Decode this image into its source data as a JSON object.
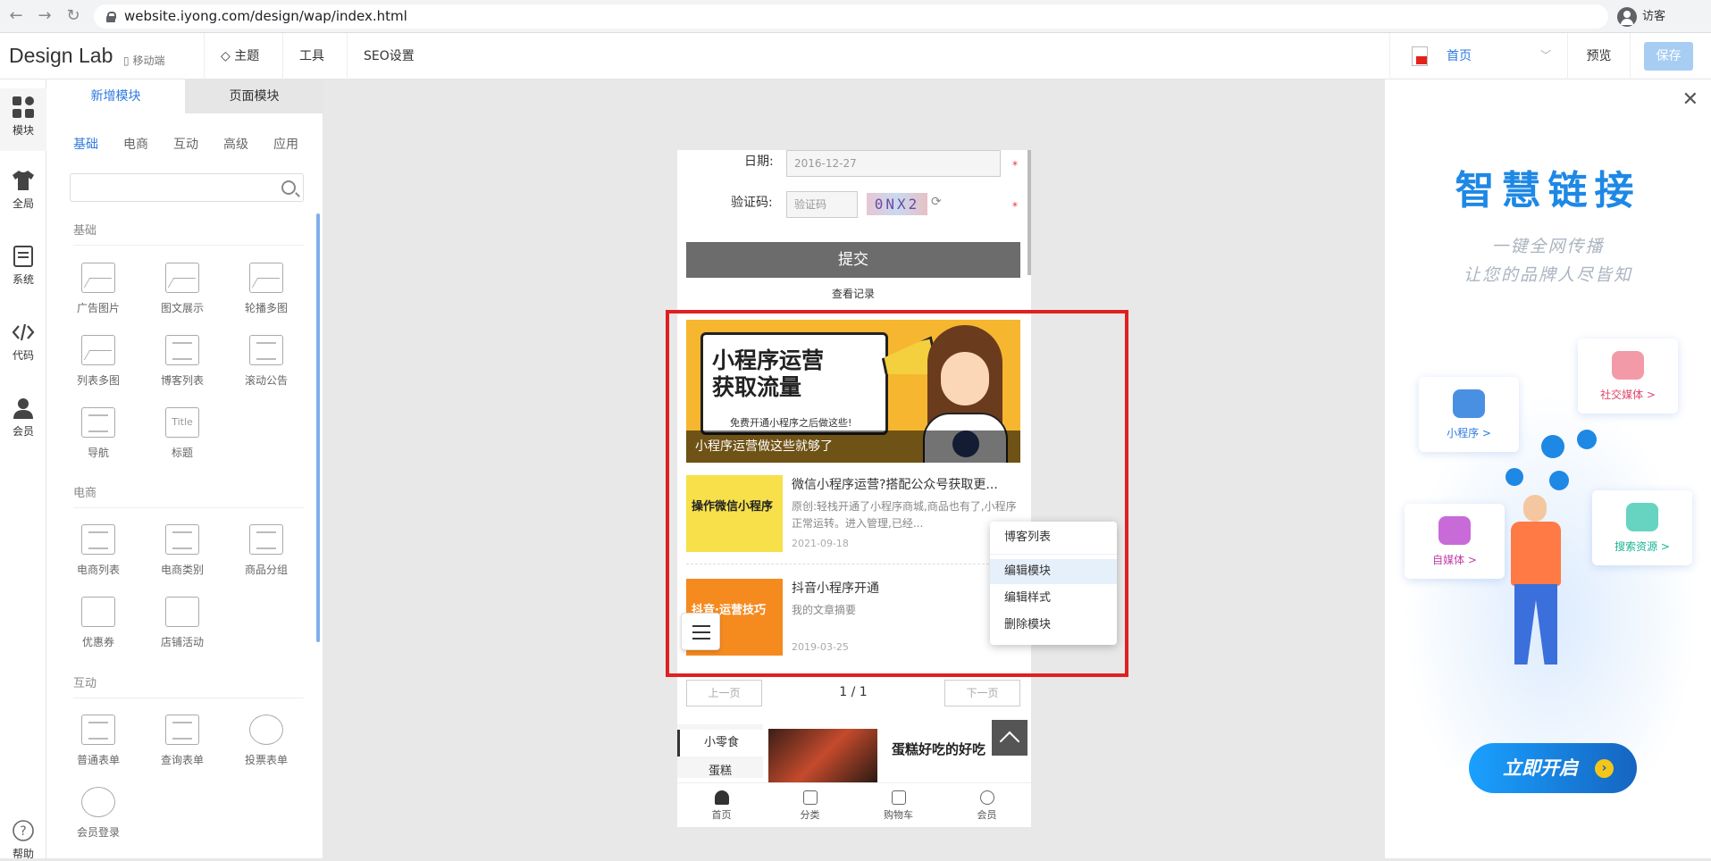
{
  "browser": {
    "url": "website.iyong.com/design/wap/index.html",
    "guest_label": "访客"
  },
  "topbar": {
    "logo": "Design Lab",
    "mobile_label": "移动端",
    "menu": [
      "主题",
      "工具",
      "SEO设置"
    ],
    "page_select": "首页",
    "preview_label": "预览",
    "save_label": "保存"
  },
  "rail": {
    "items": [
      "模块",
      "全局",
      "系统",
      "代码",
      "会员"
    ],
    "help": "帮助"
  },
  "panel": {
    "tabs": [
      "新增模块",
      "页面模块"
    ],
    "subtabs": [
      "基础",
      "电商",
      "互动",
      "高级",
      "应用"
    ],
    "groups": {
      "basic": "基础",
      "ecommerce": "电商",
      "interactive": "互动"
    },
    "basic_modules": [
      "广告图片",
      "图文展示",
      "轮播多图",
      "列表多图",
      "博客列表",
      "滚动公告",
      "导航",
      "标题"
    ],
    "ecommerce_modules": [
      "电商列表",
      "电商类别",
      "商品分组",
      "优惠券",
      "店铺活动"
    ],
    "interactive_modules": [
      "普通表单",
      "查询表单",
      "投票表单",
      "会员登录"
    ],
    "title_icon_text": "Title"
  },
  "phone": {
    "date_label": "日期:",
    "date_value": "2016-12-27",
    "captcha_label": "验证码:",
    "captcha_placeholder": "验证码",
    "captcha_code": "0NX2",
    "required_mark": "*",
    "submit_label": "提交",
    "records_label": "查看记录",
    "hero": {
      "headline_1": "小程序运营",
      "headline_2": "获取流量",
      "tagline": "免费开通小程序之后做这些!",
      "caption": "小程序运营做这些就够了"
    },
    "articles": [
      {
        "thumb_text": "操作微信小程序",
        "title": "微信小程序运营?搭配公众号获取更...",
        "desc": "原创:轻栈开通了小程序商城,商品也有了,小程序正常运转。进入管理,已经...",
        "date": "2021-09-18"
      },
      {
        "thumb_text": "抖音·运营技巧",
        "title": "抖音小程序开通",
        "desc": "我的文章摘要",
        "date": "2019-03-25"
      }
    ],
    "pager": {
      "prev": "上一页",
      "page": "1 / 1",
      "next": "下一页"
    },
    "categories": [
      "小零食",
      "蛋糕"
    ],
    "product_title": "蛋糕好吃的好吃",
    "bottom_nav": [
      "首页",
      "分类",
      "购物车",
      "会员"
    ]
  },
  "context_menu": {
    "header": "博客列表",
    "items": [
      "编辑模块",
      "编辑样式",
      "删除模块"
    ]
  },
  "ad": {
    "title": "智慧链接",
    "sub1": "一键全网传播",
    "sub2": "让您的品牌人尽皆知",
    "cards": [
      "小程序 >",
      "社交媒体 >",
      "自媒体 >",
      "搜索资源 >"
    ],
    "button": "立即开启",
    "button_icon": "›"
  },
  "colors": {
    "accent": "#2d7ae0",
    "select_border": "#e02020",
    "save_bg": "#a7cdf3"
  }
}
